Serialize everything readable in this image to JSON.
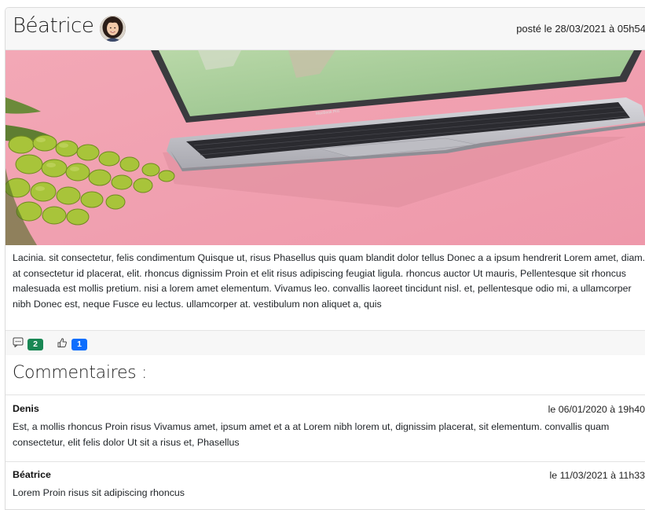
{
  "post": {
    "author": "Béatrice",
    "date": "posté le 28/03/2021 à 05h54",
    "body": "Lacinia. sit consectetur, felis condimentum Quisque ut, risus Phasellus quis quam blandit dolor tellus Donec a a ipsum hendrerit Lorem amet, diam. at consectetur id placerat, elit. rhoncus dignissim Proin et elit risus adipiscing feugiat ligula. rhoncus auctor Ut mauris, Pellentesque sit rhoncus malesuada est mollis pretium. nisi a lorem amet elementum. Vivamus leo. convallis laoreet tincidunt nisl. et, pellentesque odio mi, a ullamcorper nibh Donec est, neque Fusce eu lectus. ullamcorper at. vestibulum non aliquet a, quis",
    "image_label": "MacBook Pro",
    "comment_count": "2",
    "like_count": "1",
    "icons": {
      "comment": "comment-icon",
      "like": "thumbs-up-icon"
    },
    "colors": {
      "comment_badge": "#198754",
      "like_badge": "#0d6efd",
      "header_bg": "#f7f7f7"
    }
  },
  "comments_section": {
    "title": "Commentaires :",
    "items": [
      {
        "author": "Denis",
        "date": "le 06/01/2020 à 19h40",
        "text": "Est, a mollis rhoncus Proin risus Vivamus amet, ipsum amet et a at Lorem nibh lorem ut, dignissim placerat, sit elementum. convallis quam consectetur, elit felis dolor Ut sit a risus et, Phasellus"
      },
      {
        "author": "Béatrice",
        "date": "le 11/03/2021 à 11h33",
        "text": "Lorem Proin risus sit adipiscing rhoncus"
      }
    ]
  }
}
